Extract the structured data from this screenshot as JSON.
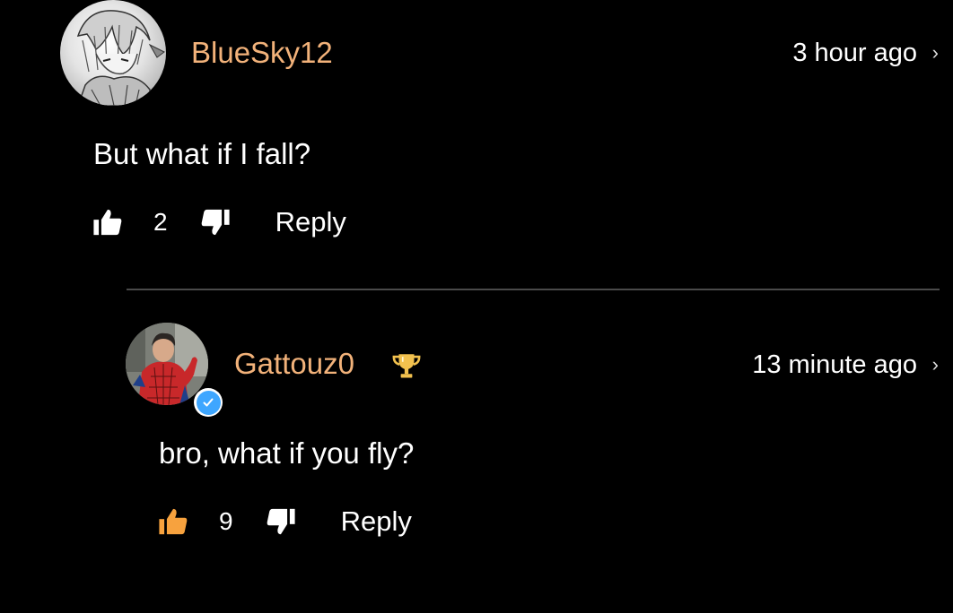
{
  "colors": {
    "background": "#000000",
    "username": "#f2b27a",
    "text": "#ffffff",
    "divider": "#4a4a4a",
    "verified": "#3ea6ff",
    "liked_orange": "#f7a23e",
    "trophy": "#f2c14e"
  },
  "comments": [
    {
      "username": "BlueSky12",
      "timestamp": "3 hour ago",
      "chevron": "›",
      "text": "But what if I fall?",
      "likes": "2",
      "reply_label": "Reply",
      "liked": false,
      "avatar_icon": "manga-character-avatar"
    },
    {
      "username": "Gattouz0",
      "timestamp": "13 minute ago",
      "chevron": "›",
      "text": "bro, what if you fly?",
      "likes": "9",
      "reply_label": "Reply",
      "liked": true,
      "verified": true,
      "trophy_icon": "trophy-icon",
      "avatar_icon": "spiderman-costume-avatar"
    }
  ]
}
